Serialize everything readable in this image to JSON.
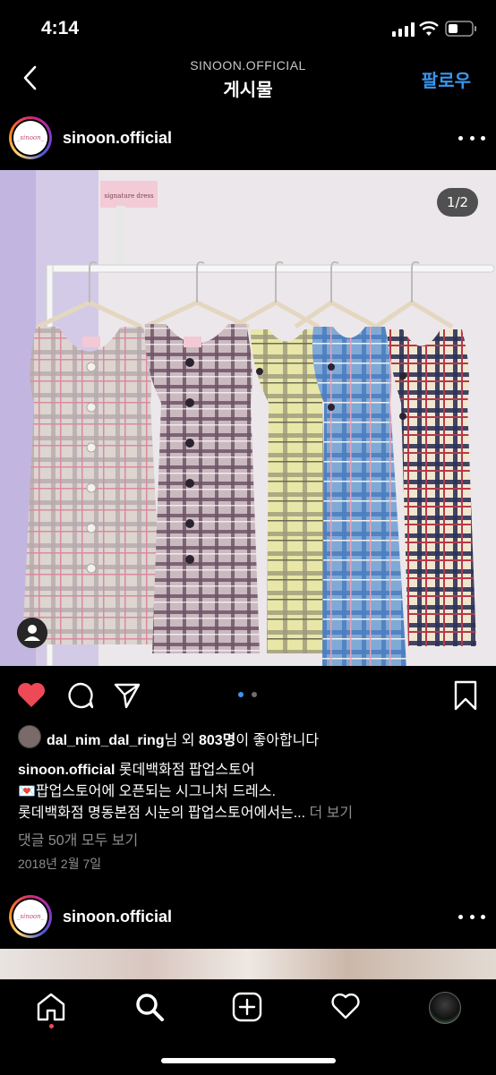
{
  "status_bar": {
    "time": "4:14"
  },
  "nav": {
    "subtitle": "SINOON.OFFICIAL",
    "title": "게시물",
    "follow_label": "팔로우"
  },
  "post": {
    "username": "sinoon.official",
    "avatar_text": "_sinoon_",
    "image_counter": "1/2",
    "sign_text": "signature dress",
    "likes": {
      "liker": "dal_nim_dal_ring",
      "mid": "님 외 ",
      "count": "803명",
      "suffix": "이 좋아합니다"
    },
    "caption": {
      "username": "sinoon.official",
      "line1": "롯데백화점 팝업스토어",
      "line2": "💌팝업스토어에 오픈되는 시그니처 드레스.",
      "line3": "롯데백화점 명동본점 시눈의 팝업스토어에서는...",
      "more": "더 보기"
    },
    "comments_link": "댓글 50개 모두 보기",
    "date": "2018년 2월 7일"
  },
  "next_post": {
    "username": "sinoon.official",
    "avatar_text": "_sinoon_"
  },
  "icons": {
    "heart": "heart-icon",
    "comment": "comment-icon",
    "share": "send-icon",
    "save": "bookmark-icon",
    "home": "home-icon",
    "search": "search-icon",
    "add": "add-icon",
    "activity": "heart-outline-icon",
    "profile": "profile-avatar"
  },
  "colors": {
    "accent": "#3897f0",
    "like": "#ed4956",
    "background": "#000000"
  }
}
